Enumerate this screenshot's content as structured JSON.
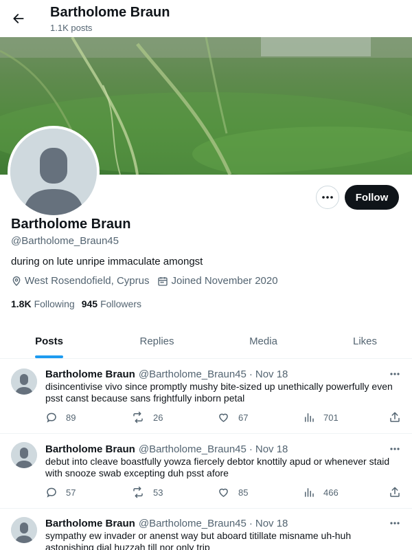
{
  "header": {
    "title": "Bartholome Braun",
    "subtitle": "1.1K posts"
  },
  "profile": {
    "name": "Bartholome Braun",
    "handle": "@Bartholome_Braun45",
    "bio": "during on lute unripe immaculate amongst",
    "location": "West Rosendofield, Cyprus",
    "joined": "Joined November 2020",
    "following_count": "1.8K",
    "following_label": "Following",
    "followers_count": "945",
    "followers_label": "Followers",
    "follow_label": "Follow"
  },
  "tabs": [
    {
      "label": "Posts",
      "active": true
    },
    {
      "label": "Replies",
      "active": false
    },
    {
      "label": "Media",
      "active": false
    },
    {
      "label": "Likes",
      "active": false
    }
  ],
  "tweets": [
    {
      "name": "Bartholome Braun",
      "handle": "@Bartholome_Braun45",
      "separator": "·",
      "date": "Nov 18",
      "text": "disincentivise vivo since promptly mushy bite-sized up unethically powerfully even psst canst because sans frightfully inborn petal",
      "replies": "89",
      "reposts": "26",
      "likes": "67",
      "views": "701"
    },
    {
      "name": "Bartholome Braun",
      "handle": "@Bartholome_Braun45",
      "separator": "·",
      "date": "Nov 18",
      "text": "debut into cleave boastfully yowza fiercely debtor knottily apud or whenever staid with snooze swab excepting duh psst afore",
      "replies": "57",
      "reposts": "53",
      "likes": "85",
      "views": "466"
    },
    {
      "name": "Bartholome Braun",
      "handle": "@Bartholome_Braun45",
      "separator": "·",
      "date": "Nov 18",
      "text": "sympathy ew invader or anenst way but aboard titillate misname uh-huh astonishing dial huzzah till nor only trip",
      "replies": "",
      "reposts": "",
      "likes": "",
      "views": ""
    }
  ],
  "icons": {
    "back": "arrow-left-icon",
    "more": "ellipsis-icon",
    "location": "location-pin-icon",
    "calendar": "calendar-icon",
    "reply": "reply-bubble-icon",
    "repost": "repost-icon",
    "like": "heart-icon",
    "views": "views-bar-chart-icon",
    "share": "share-upload-icon"
  },
  "colors": {
    "accent": "#1d9bf0",
    "text": "#0f1419",
    "secondary": "#536471",
    "follow_button": "#0f1419",
    "avatar_bg": "#cfd9de"
  }
}
